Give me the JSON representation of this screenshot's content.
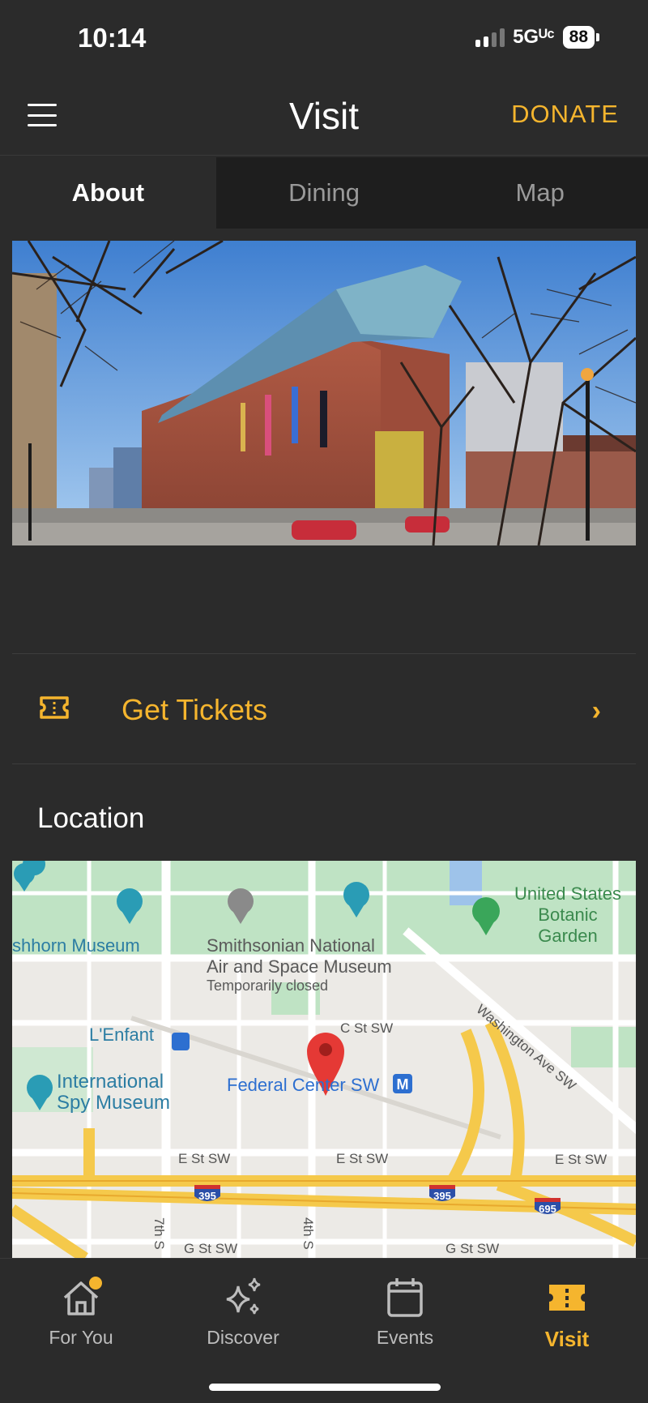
{
  "status_bar": {
    "time": "10:14",
    "network": "5Gᵁᶜ",
    "battery": "88"
  },
  "header": {
    "title": "Visit",
    "donate_label": "DONATE"
  },
  "tabs": [
    {
      "label": "About",
      "active": true
    },
    {
      "label": "Dining",
      "active": false
    },
    {
      "label": "Map",
      "active": false
    }
  ],
  "tickets": {
    "label": "Get Tickets",
    "icon": "ticket-icon",
    "chevron": "›"
  },
  "location": {
    "title": "Location",
    "map_labels": {
      "hirshhorn": "shhorn Museum",
      "air_space_1": "Smithsonian National",
      "air_space_2": "Air and Space Museum",
      "air_space_status": "Temporarily closed",
      "botanic_1": "United States",
      "botanic_2": "Botanic",
      "botanic_3": "Garden",
      "lenfant": "L'Enfant",
      "spy_1": "International",
      "spy_2": "Spy Museum",
      "federal_center": "Federal Center SW",
      "c_st": "C St SW",
      "washington_ave": "Washington Ave SW",
      "e_st_1": "E St SW",
      "e_st_2": "E St SW",
      "e_st_3": "E St SW",
      "g_st_1": "G St SW",
      "g_st_2": "G St SW",
      "seventh": "7th S",
      "fourth": "4th S",
      "i395_a": "395",
      "i395_b": "395",
      "i695": "695"
    }
  },
  "nav": [
    {
      "label": "For You",
      "icon": "home-icon",
      "active": false
    },
    {
      "label": "Discover",
      "icon": "sparkle-icon",
      "active": false
    },
    {
      "label": "Events",
      "icon": "calendar-icon",
      "active": false
    },
    {
      "label": "Visit",
      "icon": "ticket-icon",
      "active": true
    }
  ],
  "colors": {
    "accent": "#f5b52e",
    "background": "#2b2b2b",
    "tab_bar": "#1e1e1e"
  }
}
